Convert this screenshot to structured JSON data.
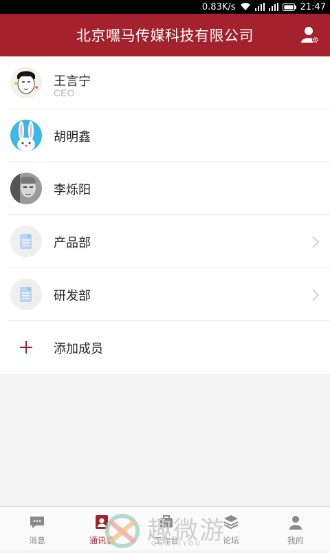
{
  "status": {
    "speed": "0.83K/s",
    "time": "21:47"
  },
  "header": {
    "title": "北京嘿马传媒科技有限公司",
    "profile_icon": "user-settings-icon"
  },
  "contacts": [
    {
      "name": "王言宁",
      "subtitle": "CEO",
      "avatar": "avatar-cartoon-man"
    },
    {
      "name": "胡明鑫",
      "avatar": "avatar-bunny"
    },
    {
      "name": "李烁阳",
      "avatar": "avatar-photo"
    }
  ],
  "departments": [
    {
      "name": "产品部",
      "icon": "document-icon"
    },
    {
      "name": "研发部",
      "icon": "document-icon"
    }
  ],
  "add_member": {
    "label": "添加成员"
  },
  "tabs": [
    {
      "label": "消息",
      "icon": "chat-icon",
      "active": false
    },
    {
      "label": "通讯录",
      "icon": "contacts-icon",
      "active": true
    },
    {
      "label": "工作台",
      "icon": "workbench-icon",
      "active": false
    },
    {
      "label": "论坛",
      "icon": "forum-icon",
      "active": false
    },
    {
      "label": "我的",
      "icon": "person-icon",
      "active": false
    }
  ],
  "watermark": {
    "text": "趣微游",
    "sub": "QUWEIYOU"
  },
  "colors": {
    "brand": "#a3222d",
    "tab_inactive": "#888888"
  }
}
